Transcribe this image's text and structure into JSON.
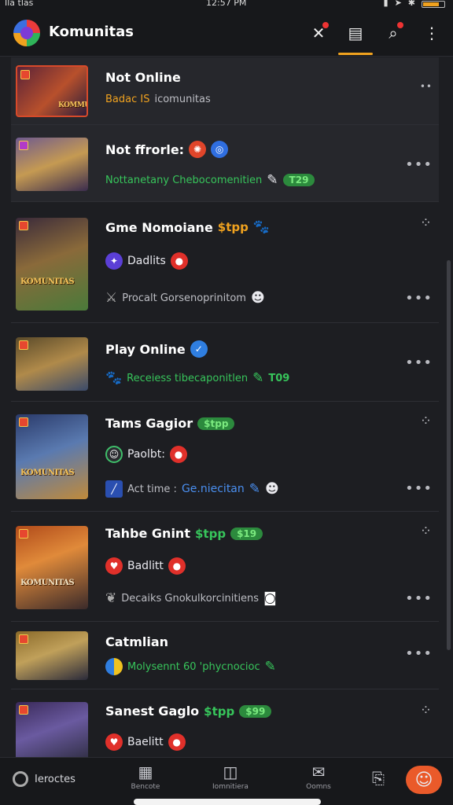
{
  "status_bar": {
    "left": "Ila tlas",
    "time": "12:57 PM"
  },
  "app": {
    "title": "Komunitas"
  },
  "cards": [
    {
      "thumb_text": "KOMMU",
      "title": "Not Online",
      "sub_orange": "Badac IS",
      "sub_grey": "icomunitas"
    },
    {
      "title": "Not ffrorle:",
      "sub_green": "Nottanetany Chebocomenitien",
      "sub_pill": "T29"
    },
    {
      "thumb_text": "KOMUNITAS",
      "title": "Gme Nomoiane",
      "title_tag": "$tpp",
      "line2": "Dadlits",
      "line3": "Procalt Gorsenoprinitom"
    },
    {
      "title": "Play Online",
      "sub_green": "Receiess tibecaponitlen",
      "sub_tail": "T09"
    },
    {
      "thumb_text": "KOMUNITAS",
      "title": "Tams Gagior",
      "title_pill": "$tpp",
      "line2": "Paolbt:",
      "line3_grey": "Act time :",
      "line3_blue": "Ge.niecitan"
    },
    {
      "thumb_text": "KOMUNITAS",
      "title": "Tahbe Gnint",
      "title_tag": "$tpp",
      "title_pill": "$19",
      "line2": "Badlitt",
      "line3": "Decaiks Gnokulkorcinitiens"
    },
    {
      "title": "Catmlian",
      "sub_green": "Molysennt 60 'phycnocioc"
    },
    {
      "title": "Sanest Gaglo",
      "title_tag": "$tpp",
      "title_pill": "$99",
      "line2": "Baelitt"
    }
  ],
  "bottom_nav": {
    "left_label": "Ieroctes",
    "items": [
      {
        "label": "Bencote"
      },
      {
        "label": "Iomnitiera"
      },
      {
        "label": "Oomns"
      }
    ]
  }
}
